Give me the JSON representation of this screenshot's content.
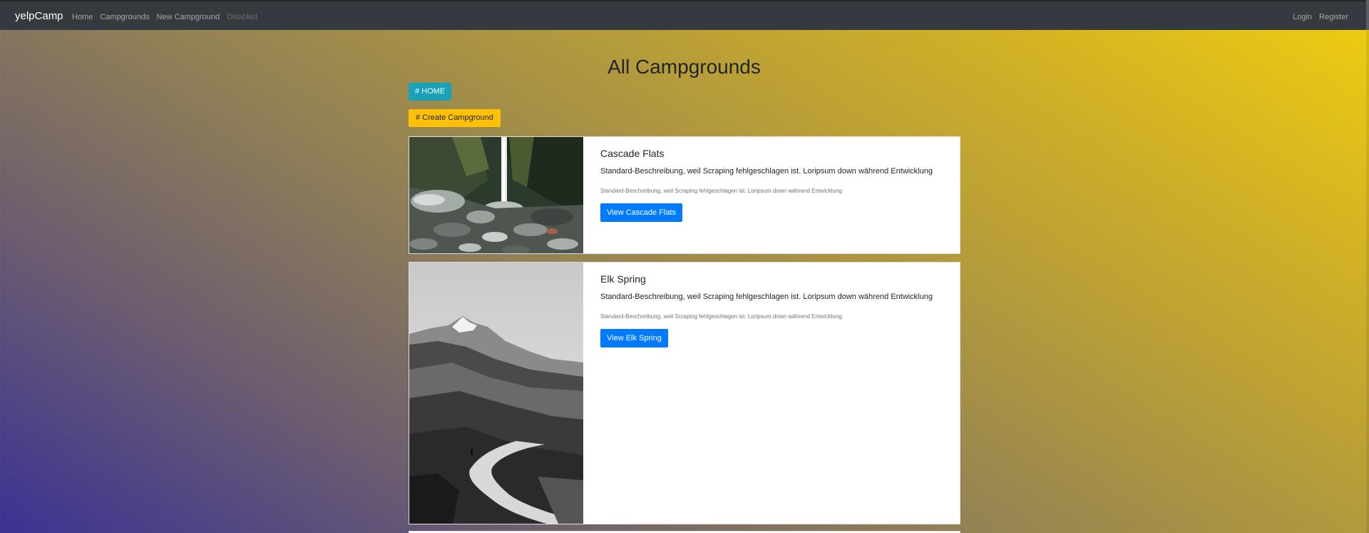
{
  "navbar": {
    "brand": "yelpCamp",
    "links": [
      "Home",
      "Campgrounds",
      "New Campground",
      "Disabled"
    ],
    "right_links": [
      "Login",
      "Register"
    ]
  },
  "main": {
    "title": "All Campgrounds",
    "home_button": "# HOME",
    "create_button": "# Create Campground"
  },
  "campgrounds": [
    {
      "name": "Cascade Flats",
      "description": "Standard-Beschreibung, weil Scraping fehlgeschlagen ist. Loripsum down während Entwicklung",
      "subtext": "Standard-Beschreibung, weil Scraping fehlgeschlagen ist. Loripsum down während Entwicklung",
      "button": "View Cascade Flats",
      "image": "waterfall-photo"
    },
    {
      "name": "Elk Spring",
      "description": "Standard-Beschreibung, weil Scraping fehlgeschlagen ist. Loripsum down während Entwicklung",
      "subtext": "Standard-Beschreibung, weil Scraping fehlgeschlagen ist. Loripsum down während Entwicklung",
      "button": "View Elk Spring",
      "image": "mountain-trail-photo"
    }
  ],
  "colors": {
    "navbar": "#343a40",
    "info": "#17a2b8",
    "warning": "#ffc107",
    "primary": "#007bff"
  }
}
